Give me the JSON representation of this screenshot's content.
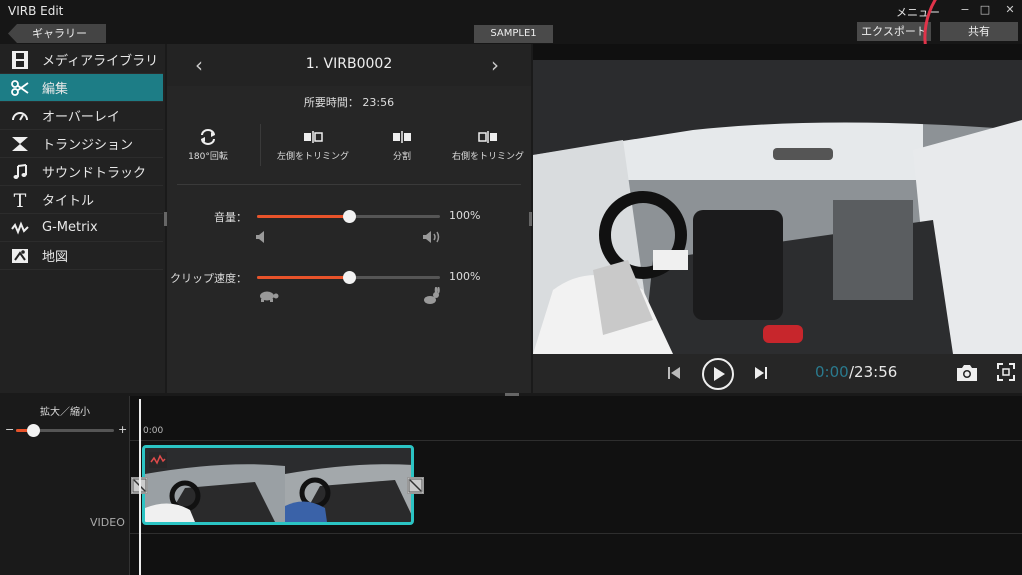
{
  "app": {
    "title": "VIRB Edit",
    "menu_label": "メニュー",
    "window_controls": {
      "minimize": "−",
      "maximize": "□",
      "close": "✕"
    }
  },
  "toolbar": {
    "gallery_label": "ギャラリー",
    "project_tab": "SAMPLE1",
    "export_label": "エクスポート",
    "share_label": "共有"
  },
  "sidebar": {
    "items": [
      {
        "label": "メディアライブラリ",
        "icon": "film-icon"
      },
      {
        "label": "編集",
        "icon": "scissors-icon",
        "active": true
      },
      {
        "label": "オーバーレイ",
        "icon": "gauge-icon"
      },
      {
        "label": "トランジション",
        "icon": "transition-icon"
      },
      {
        "label": "サウンドトラック",
        "icon": "music-note-icon"
      },
      {
        "label": "タイトル",
        "icon": "title-t-icon"
      },
      {
        "label": "G-Metrix",
        "icon": "gmetrix-icon"
      },
      {
        "label": "地図",
        "icon": "map-icon"
      }
    ]
  },
  "edit": {
    "clip_title": "1. VIRB0002",
    "duration_label": "所要時間： 23:56",
    "tools": [
      {
        "label": "180°回転",
        "icon": "rotate-icon"
      },
      {
        "label": "左側をトリミング",
        "icon": "trim-left-icon"
      },
      {
        "label": "分割",
        "icon": "split-icon"
      },
      {
        "label": "右側をトリミング",
        "icon": "trim-right-icon"
      }
    ],
    "volume": {
      "label": "音量：",
      "value_pct": 100,
      "value_text": "100%",
      "knob_fraction": 0.5
    },
    "speed": {
      "label": "クリップ速度：",
      "value_pct": 100,
      "value_text": "100%",
      "knob_fraction": 0.5
    }
  },
  "preview": {
    "current_time": "0:00",
    "total_time": "/23:56",
    "accent_color": "#2a7a8e"
  },
  "timeline": {
    "zoom_label": "拡大／縮小",
    "zoom_minus": "−",
    "zoom_plus": "+",
    "zoom_fraction": 0.17,
    "ruler_start": "0:00",
    "track_label": "VIDEO",
    "clip_border_color": "#2bc4c4"
  }
}
